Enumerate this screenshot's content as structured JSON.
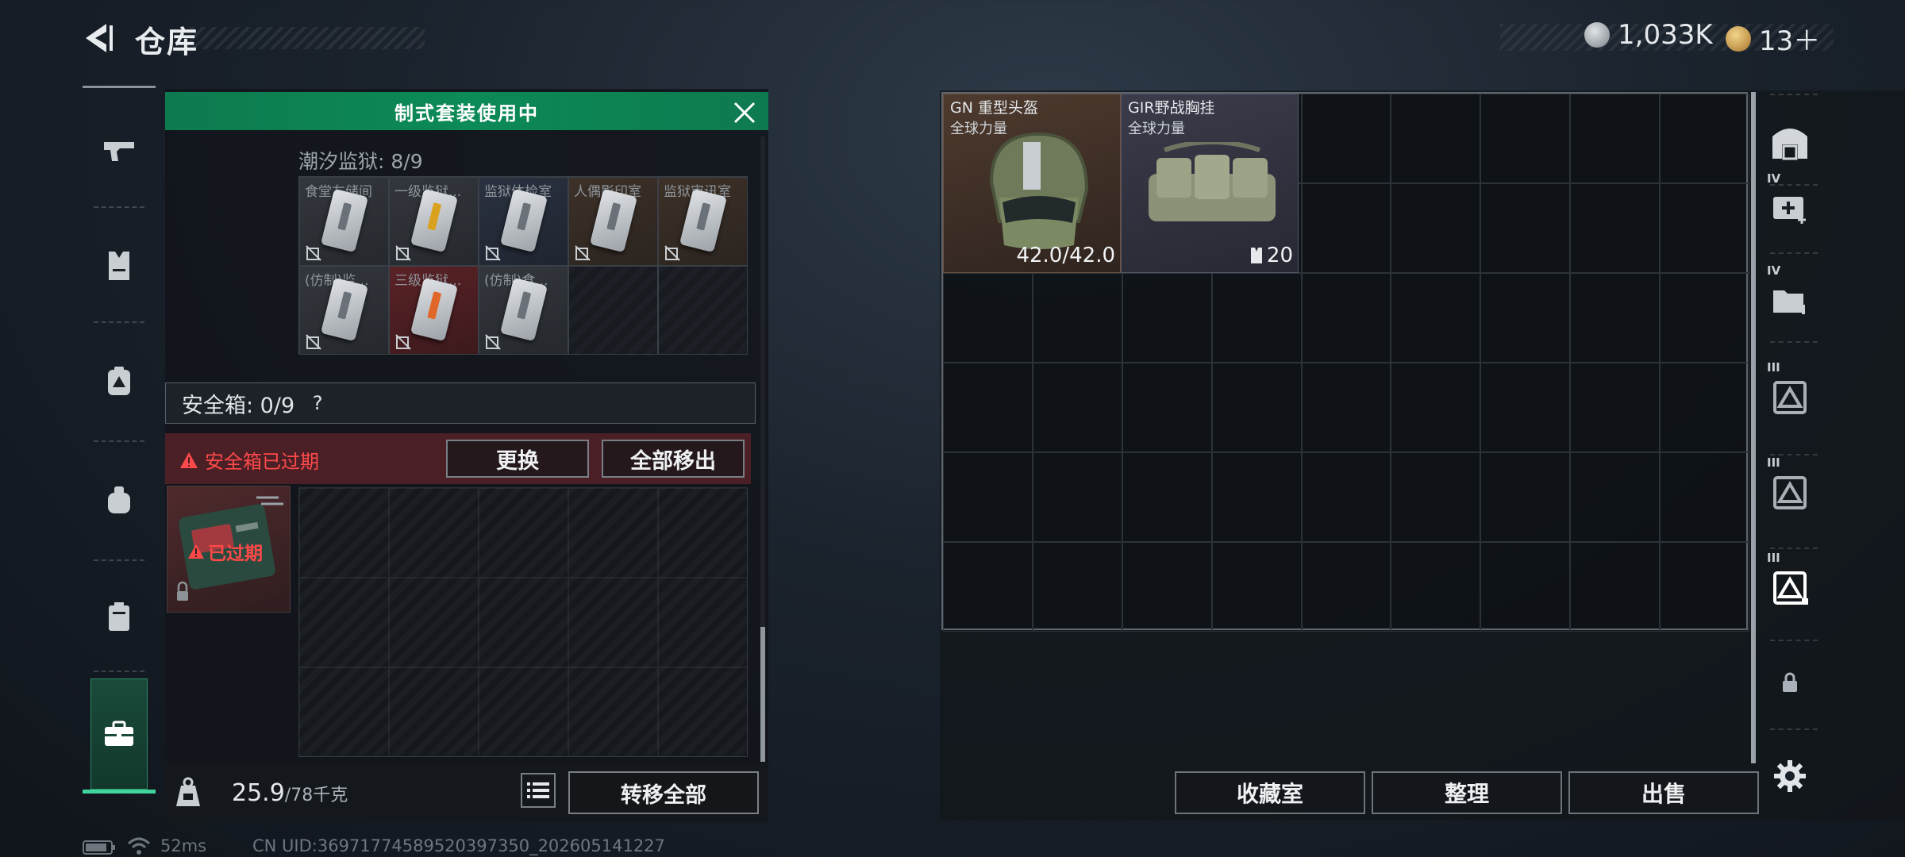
{
  "header": {
    "title": "仓库",
    "currency": [
      {
        "icon": "silver-coin-icon",
        "value": "1,033K"
      },
      {
        "icon": "gold-coin-icon",
        "value": "13＋"
      }
    ]
  },
  "left_nav": {
    "items": [
      "pistol-icon",
      "armor-vest-icon",
      "backpack-icon",
      "pouch-icon",
      "case-icon",
      "toolbox-icon"
    ]
  },
  "loadout": {
    "banner": "制式套装使用中",
    "keychain_label": "潮汐监狱: 8/9",
    "keys": [
      {
        "name": "食堂左储间",
        "tone": "gray",
        "card": "plain"
      },
      {
        "name": "一级监狱...",
        "tone": "gray",
        "card": "yellow"
      },
      {
        "name": "监狱体检室",
        "tone": "blue",
        "card": "plain"
      },
      {
        "name": "人偶影印室",
        "tone": "brown",
        "card": "plain"
      },
      {
        "name": "监狱审讯室",
        "tone": "brown",
        "card": "plain"
      },
      {
        "name": "(仿制)监...",
        "tone": "gray",
        "card": "plain"
      },
      {
        "name": "三级监狱...",
        "tone": "red",
        "card": "orange"
      },
      {
        "name": "(仿制)食...",
        "tone": "gray",
        "card": "plain"
      },
      {
        "name": "",
        "tone": "empty",
        "card": "none"
      },
      {
        "name": "",
        "tone": "empty",
        "card": "none"
      }
    ],
    "safebox_label": "安全箱: 0/9",
    "help": "?",
    "expired_warning": "安全箱已过期",
    "replace_button": "更换",
    "move_all_out_button": "全部移出",
    "safebox_status": "已过期",
    "weight_value": "25.9",
    "weight_unit": "/78千克",
    "transfer_all_button": "转移全部"
  },
  "storage": {
    "items": [
      {
        "name": "GN 重型头盔",
        "tag": "全球力量",
        "value": "42.0/42.0"
      },
      {
        "name": "GIR野战胸挂",
        "tag": "全球力量",
        "value": "20"
      }
    ],
    "right_nav": [
      {
        "icon": "storage-home-icon",
        "tier": ""
      },
      {
        "icon": "medical-case-icon",
        "tier": "IV"
      },
      {
        "icon": "file-case-icon",
        "tier": "IV"
      },
      {
        "icon": "container-icon",
        "tier": "III"
      },
      {
        "icon": "container-icon",
        "tier": "III"
      },
      {
        "icon": "container-icon",
        "tier": "III"
      },
      {
        "icon": "lock-icon",
        "tier": ""
      },
      {
        "icon": "gear-icon",
        "tier": ""
      }
    ],
    "buttons": {
      "collection": "收藏室",
      "organize": "整理",
      "sell": "出售"
    }
  },
  "status_bar": {
    "ping": "52ms",
    "uid": "CN UID:36971774589520397350_202605141227"
  }
}
